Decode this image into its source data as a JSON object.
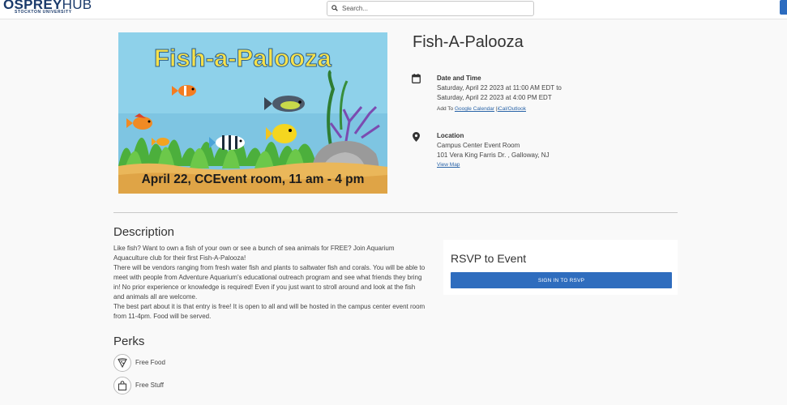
{
  "header": {
    "logo_main_a": "OSPREY",
    "logo_main_b": "HUB",
    "logo_sub": "STOCKTON UNIVERSITY",
    "search_placeholder": "Search..."
  },
  "event": {
    "title": "Fish-A-Palooza",
    "banner": {
      "title_text": "Fish-a-Palooza",
      "caption": "April 22, CCEvent room, 11 am - 4 pm"
    },
    "date_time": {
      "label": "Date and Time",
      "line1": "Saturday, April 22 2023 at 11:00 AM EDT to",
      "line2": "Saturday, April 22 2023 at 4:00 PM EDT",
      "add_to": "Add To",
      "google_link": "Google Calendar",
      "separator": "|",
      "ical_link": "iCal/Outlook"
    },
    "location": {
      "label": "Location",
      "name": "Campus Center Event Room",
      "address": "101 Vera King Farris Dr. , Galloway, NJ",
      "map_link": "View Map"
    }
  },
  "description": {
    "heading": "Description",
    "paragraphs": [
      "Like fish? Want to own a fish of your own or see a bunch of sea animals for FREE? Join Aquarium Aquaculture club for their first Fish-A-Palooza!",
      "There will be vendors ranging from fresh water fish and plants to saltwater fish and corals. You will be able to meet with people from Adventure Aquarium's educational outreach program and see what friends they bring in! No prior experience or knowledge is required! Even if you just want to stroll around and look at the fish and animals all are welcome.",
      "The best part about it is that entry is free! It is open to all and will be hosted in the campus center event room from 11-4pm. Food will be served."
    ]
  },
  "perks": {
    "heading": "Perks",
    "items": [
      {
        "label": "Free Food",
        "icon": "pizza-icon"
      },
      {
        "label": "Free Stuff",
        "icon": "shopping-bag-icon"
      }
    ]
  },
  "rsvp": {
    "heading": "RSVP to Event",
    "button": "SIGN IN TO RSVP"
  }
}
